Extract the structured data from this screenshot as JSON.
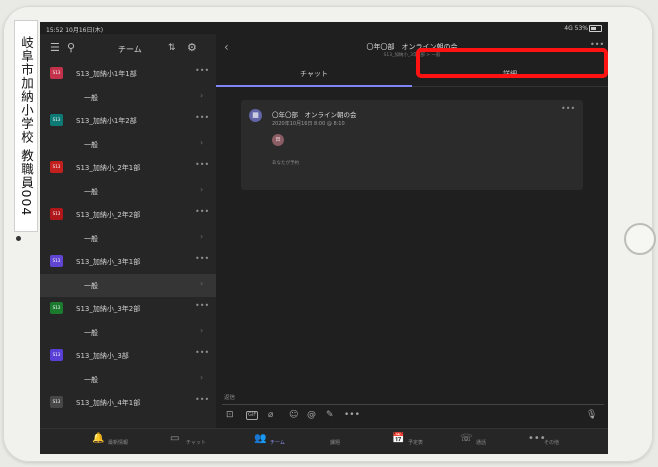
{
  "sticker": {
    "text": "岐阜市加納小学校 教職員004"
  },
  "status_bar": {
    "time": "15:52  10月16日(木)",
    "right": "4G 53%"
  },
  "left_header": {
    "title": "チーム"
  },
  "teams": [
    {
      "name": "S13_加納小1年1部",
      "avatar": "S13",
      "color": "#c4314b",
      "channel": "一般"
    },
    {
      "name": "S13_加納小1年2部",
      "avatar": "S13",
      "color": "#0e7a75",
      "channel": "一般"
    },
    {
      "name": "S13_加納小_2年1部",
      "avatar": "S13",
      "color": "#c21f1f",
      "channel": "一般"
    },
    {
      "name": "S13_加納小_2年2部",
      "avatar": "S13",
      "color": "#b0171b",
      "channel": "一般"
    },
    {
      "name": "S13_加納小_3年1部",
      "avatar": "S13",
      "color": "#6045d2",
      "channel": "一般",
      "selected": true
    },
    {
      "name": "S13_加納小_3年2部",
      "avatar": "S13",
      "color": "#1c7a2f",
      "channel": "一般"
    },
    {
      "name": "S13_加納小_3部",
      "avatar": "S13",
      "color": "#5a3fd6",
      "channel": "一般"
    },
    {
      "name": "S13_加納小_4年1部",
      "avatar": "S13",
      "color": "#474747"
    }
  ],
  "right_header": {
    "title": "〇年〇部　オンライン朝の会",
    "subtitle": "S13_加納小_3年1部 > 一般"
  },
  "tabs": {
    "chat": "チャット",
    "details": "詳細"
  },
  "meeting_card": {
    "title": "〇年〇部　オンライン朝の会",
    "datetime": "2020年10月16日 8:00 @ 8:10",
    "attendee_initial": "田",
    "footer": "あなたが予約"
  },
  "reply": {
    "placeholder": "返信"
  },
  "app_bar": [
    {
      "icon": "🔔",
      "label": "最新情報",
      "active": false
    },
    {
      "icon": "▭",
      "label": "チャット",
      "active": false
    },
    {
      "icon": "👥",
      "label": "チーム",
      "active": true
    },
    {
      "icon": "",
      "label": "課題",
      "active": false
    },
    {
      "icon": "📅",
      "label": "予定表",
      "active": false
    },
    {
      "icon": "☏",
      "label": "通話",
      "active": false
    },
    {
      "icon": "•••",
      "label": "その他",
      "active": false
    }
  ],
  "colors": {
    "accent": "#7f85f5",
    "highlight": "#ff1212"
  }
}
